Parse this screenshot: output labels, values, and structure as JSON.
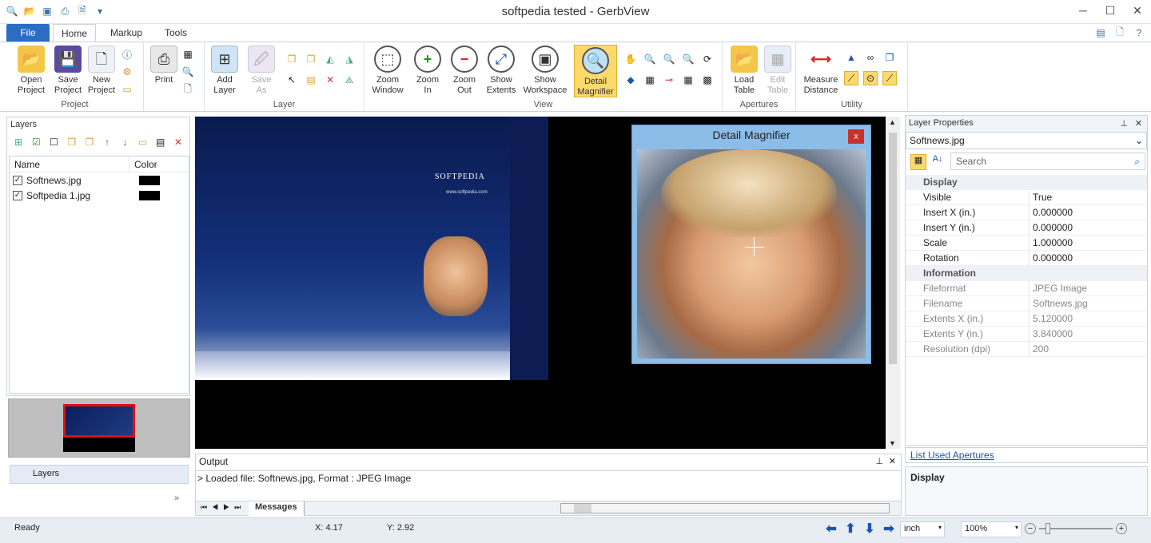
{
  "window": {
    "title": "softpedia tested - GerbView",
    "min": "─",
    "max": "☐",
    "close": "✕"
  },
  "tabs": {
    "file": "File",
    "home": "Home",
    "markup": "Markup",
    "tools": "Tools"
  },
  "ribbon": {
    "project": {
      "label": "Project",
      "open": "Open\nProject",
      "save": "Save\nProject",
      "new": "New\nProject",
      "print": "Print"
    },
    "layer": {
      "label": "Layer",
      "add": "Add\nLayer",
      "saveas": "Save\nAs"
    },
    "view": {
      "label": "View",
      "zoom_window": "Zoom\nWindow",
      "zoom_in": "Zoom\nIn",
      "zoom_out": "Zoom\nOut",
      "show_extents": "Show\nExtents",
      "show_workspace": "Show\nWorkspace",
      "detail_magnifier": "Detail\nMagnifier"
    },
    "apertures": {
      "label": "Apertures",
      "load_table": "Load\nTable",
      "edit_table": "Edit\nTable"
    },
    "utility": {
      "label": "Utility",
      "measure": "Measure\nDistance"
    }
  },
  "layers": {
    "title": "Layers",
    "col_name": "Name",
    "col_color": "Color",
    "rows": [
      {
        "name": "Softnews.jpg",
        "checked": true,
        "color": "#000000"
      },
      {
        "name": "Softpedia 1.jpg",
        "checked": true,
        "color": "#000000"
      }
    ],
    "tab_label": "Layers"
  },
  "magnifier": {
    "title": "Detail Magnifier",
    "close": "x"
  },
  "image_overlay": {
    "logo": "SOFTPEDIA",
    "url": "www.softpedia.com"
  },
  "output": {
    "title": "Output",
    "message": "> Loaded file: Softnews.jpg, Format : JPEG Image",
    "tab": "Messages"
  },
  "properties": {
    "title": "Layer Properties",
    "selected": "Softnews.jpg",
    "search_placeholder": "Search",
    "display_cat": "Display",
    "visible_k": "Visible",
    "visible_v": "True",
    "insx_k": "Insert X (in.)",
    "insx_v": "0.000000",
    "insy_k": "Insert Y (in.)",
    "insy_v": "0.000000",
    "scale_k": "Scale",
    "scale_v": "1.000000",
    "rot_k": "Rotation",
    "rot_v": "0.000000",
    "info_cat": "Information",
    "fmt_k": "Fileformat",
    "fmt_v": "JPEG Image",
    "fname_k": "Filename",
    "fname_v": "Softnews.jpg",
    "extx_k": "Extents X (in.)",
    "extx_v": "5.120000",
    "exty_k": "Extents Y (in.)",
    "exty_v": "3.840000",
    "res_k": "Resolution (dpi)",
    "res_v": "200",
    "link": "List Used Apertures",
    "desc": "Display"
  },
  "status": {
    "ready": "Ready",
    "x": "X: 4.17",
    "y": "Y: 2.92",
    "unit": "inch",
    "zoom": "100%"
  },
  "colors": {
    "accent": "#2b6cc4",
    "highlight": "#fbd96d"
  }
}
